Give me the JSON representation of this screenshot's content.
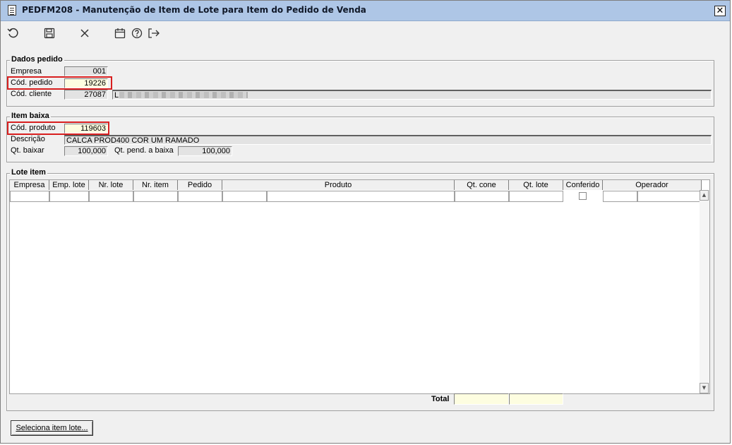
{
  "window": {
    "title": "PEDFM208 - Manutenção de Item de Lote para Item do Pedido de Venda",
    "close_glyph": "✕"
  },
  "toolbar": {
    "undo_icon": "↺",
    "save_icon": "💾",
    "cancel_icon": "✕",
    "calendar_icon": "📅",
    "help_icon": "?",
    "exit_icon": "⇥"
  },
  "dados_pedido": {
    "title": "Dados pedido",
    "empresa_label": "Empresa",
    "empresa_value": "001",
    "cod_pedido_label": "Cód. pedido",
    "cod_pedido_value": "19226",
    "cod_cliente_label": "Cód. cliente",
    "cod_cliente_value": "27087",
    "cliente_nome_prefix": "L"
  },
  "item_baixa": {
    "title": "Item baixa",
    "cod_produto_label": "Cód. produto",
    "cod_produto_value": "119603",
    "descricao_label": "Descrição",
    "descricao_value": "CALCA PROD400 COR UM RAMADO",
    "qt_baixar_label": "Qt. baixar",
    "qt_baixar_value": "100,000",
    "qt_pend_label": "Qt. pend. a baixa",
    "qt_pend_value": "100,000"
  },
  "lote_item": {
    "title": "Lote item",
    "columns": [
      "Empresa",
      "Emp. lote",
      "Nr. lote",
      "Nr. item",
      "Pedido",
      "Produto",
      "Qt. cone",
      "Qt. lote",
      "Conferido",
      "Operador"
    ],
    "total_label": "Total"
  },
  "footer": {
    "seleciona_label": "Seleciona item lote..."
  },
  "colors": {
    "titlebar": "#aec6e6",
    "highlight": "#d81f1f",
    "total_field": "#fdfde0"
  }
}
